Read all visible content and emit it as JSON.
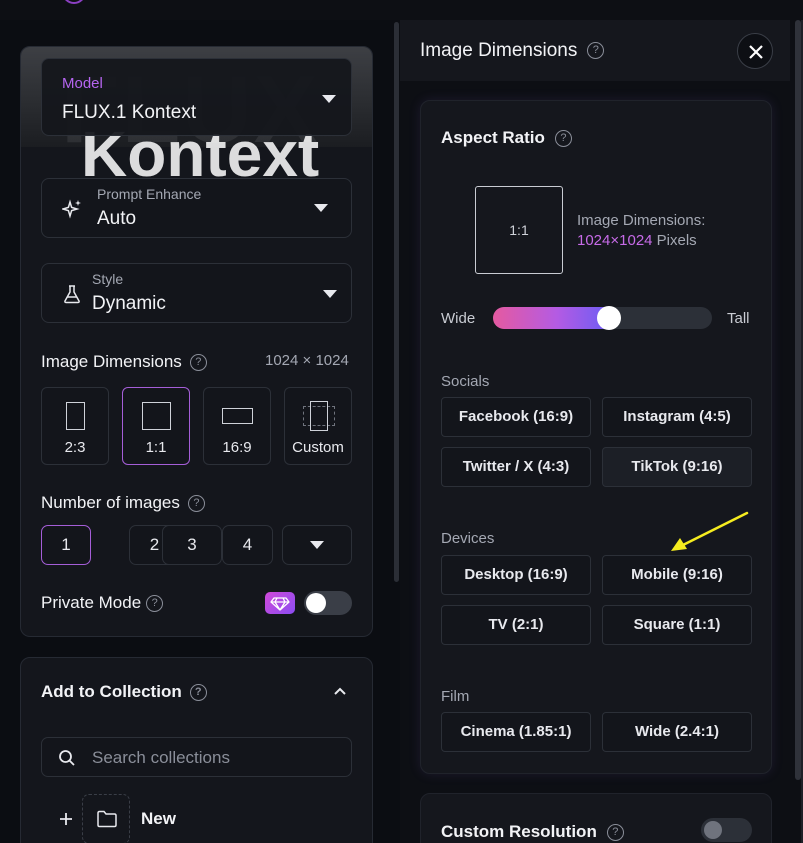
{
  "left": {
    "model": {
      "label": "Model",
      "value": "FLUX.1 Kontext",
      "bg_text": "FLUX",
      "bg_text2": "Kontext"
    },
    "prompt_enhance": {
      "label": "Prompt Enhance",
      "value": "Auto"
    },
    "style": {
      "label": "Style",
      "value": "Dynamic"
    },
    "image_dimensions": {
      "title": "Image Dimensions",
      "readout": "1024 × 1024",
      "options": [
        "2:3",
        "1:1",
        "16:9",
        "Custom"
      ],
      "selected": "1:1"
    },
    "number_of_images": {
      "title": "Number of images",
      "options": [
        "1",
        "2",
        "3",
        "4"
      ],
      "selected": "1"
    },
    "private_mode": {
      "title": "Private Mode",
      "enabled": false
    },
    "collection": {
      "title": "Add to Collection",
      "search_placeholder": "Search collections",
      "new_label": "New"
    }
  },
  "modal": {
    "title": "Image Dimensions",
    "aspect_ratio": {
      "title": "Aspect Ratio",
      "preview_label": "1:1",
      "dimensions_label": "Image Dimensions:",
      "dimensions_value": "1024×1024",
      "dimensions_unit": "Pixels",
      "slider": {
        "left_label": "Wide",
        "right_label": "Tall",
        "value_fraction": 0.53
      }
    },
    "groups": [
      {
        "label": "Socials",
        "options": [
          "Facebook (16:9)",
          "Instagram (4:5)",
          "Twitter / X (4:3)",
          "TikTok (9:16)"
        ]
      },
      {
        "label": "Devices",
        "options": [
          "Desktop (16:9)",
          "Mobile (9:16)",
          "TV (2:1)",
          "Square (1:1)"
        ]
      },
      {
        "label": "Film",
        "options": [
          "Cinema (1.85:1)",
          "Wide (2.4:1)"
        ]
      }
    ],
    "custom_resolution": {
      "title": "Custom Resolution",
      "enabled": false
    }
  },
  "colors": {
    "accent": "#b565f0",
    "gradient_start": "#e55aa0",
    "gradient_end": "#6d5cf4",
    "annotation_arrow": "#f5ec1f"
  },
  "icons": [
    "sparkles-icon",
    "flask-icon",
    "help-icon",
    "gem-icon",
    "close-icon",
    "search-icon",
    "folder-icon",
    "plus-icon",
    "chevron-up-icon",
    "caret-down-icon"
  ]
}
